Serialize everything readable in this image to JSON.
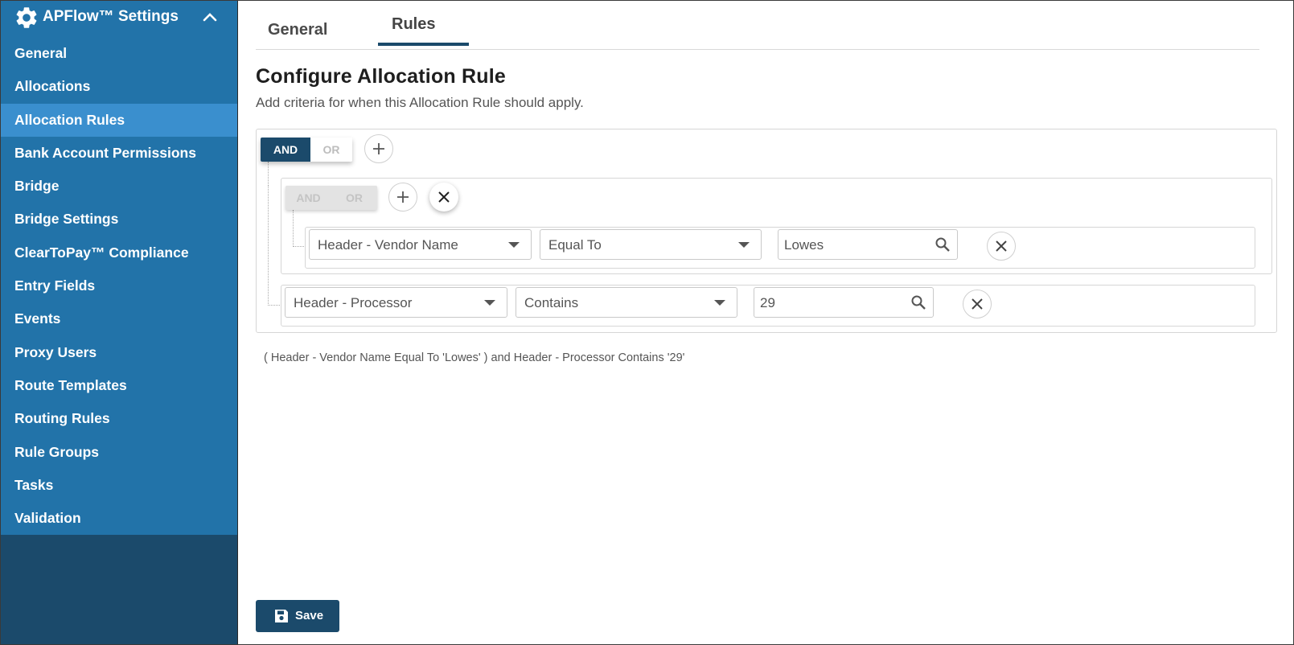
{
  "app": {
    "title": "APFlow™ Settings"
  },
  "sidebar": {
    "items": [
      {
        "label": "General"
      },
      {
        "label": "Allocations"
      },
      {
        "label": "Allocation Rules"
      },
      {
        "label": "Bank Account Permissions"
      },
      {
        "label": "Bridge"
      },
      {
        "label": "Bridge Settings"
      },
      {
        "label": "ClearToPay™ Compliance"
      },
      {
        "label": "Entry Fields"
      },
      {
        "label": "Events"
      },
      {
        "label": "Proxy Users"
      },
      {
        "label": "Route Templates"
      },
      {
        "label": "Routing Rules"
      },
      {
        "label": "Rule Groups"
      },
      {
        "label": "Tasks"
      },
      {
        "label": "Validation"
      }
    ],
    "active": "Allocation Rules"
  },
  "tabs": [
    {
      "label": "General"
    },
    {
      "label": "Rules"
    }
  ],
  "active_tab": "Rules",
  "page": {
    "title": "Configure Allocation Rule",
    "subtitle": "Add criteria for when this Allocation Rule should apply."
  },
  "rule": {
    "root_toggle": {
      "and": "AND",
      "or": "OR",
      "selected": "AND"
    },
    "group_toggle": {
      "and": "AND",
      "or": "OR",
      "selected": "none"
    },
    "conditions": [
      {
        "field": "Header - Vendor Name",
        "operator": "Equal To",
        "value": "Lowes"
      },
      {
        "field": "Header - Processor",
        "operator": "Contains",
        "value": "29"
      }
    ],
    "summary": "( Header - Vendor Name Equal To 'Lowes' ) and Header - Processor Contains '29'"
  },
  "footer": {
    "save_label": "Save"
  },
  "colors": {
    "sidebar_top": "#2273a9",
    "sidebar_bottom": "#1b4a6b",
    "active_item": "#3a8fce",
    "primary": "#1b4a6b"
  }
}
